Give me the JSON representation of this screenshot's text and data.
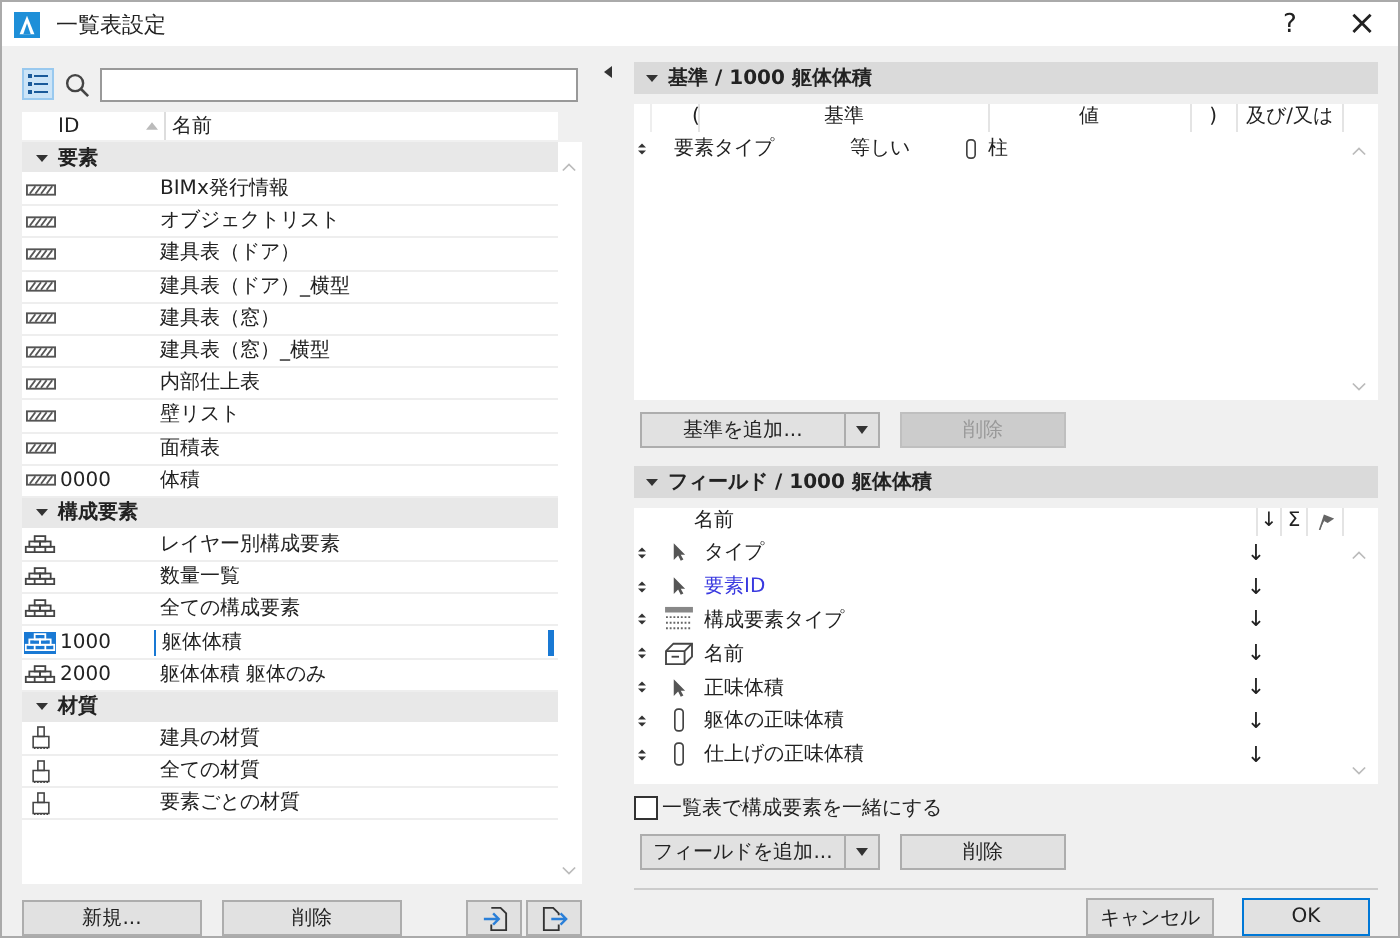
{
  "window": {
    "title": "一覧表設定",
    "help": "?",
    "close": "×"
  },
  "list": {
    "columns": [
      "ID",
      "名前"
    ],
    "groups": [
      {
        "label": "要素",
        "expanded": true,
        "items": [
          {
            "kind": "element",
            "name": "BIMx発行情報",
            "selected": false
          },
          {
            "kind": "element",
            "name": "オブジェクトリスト",
            "selected": false
          },
          {
            "kind": "element",
            "name": "建具表（ドア）",
            "selected": false
          },
          {
            "kind": "element",
            "name": "建具表（ドア）_横型",
            "selected": false
          },
          {
            "kind": "element",
            "name": "建具表（窓）",
            "selected": false
          },
          {
            "kind": "element",
            "name": "建具表（窓）_横型",
            "selected": false
          },
          {
            "kind": "element",
            "name": "内部仕上表",
            "selected": false
          },
          {
            "kind": "element",
            "name": "壁リスト",
            "selected": false
          },
          {
            "kind": "element",
            "name": "面積表",
            "selected": false
          },
          {
            "kind": "element",
            "id": "0000",
            "name": "体積",
            "selected": false
          }
        ]
      },
      {
        "label": "構成要素",
        "expanded": true,
        "items": [
          {
            "kind": "component",
            "name": "レイヤー別構成要素",
            "selected": false
          },
          {
            "kind": "component",
            "name": "数量一覧",
            "selected": false
          },
          {
            "kind": "component",
            "name": "全ての構成要素",
            "selected": false
          },
          {
            "kind": "component",
            "id": "1000",
            "name": "躯体体積",
            "selected": true
          },
          {
            "kind": "component",
            "id": "2000",
            "name": "躯体体積 躯体のみ",
            "selected": false
          }
        ]
      },
      {
        "label": "材質",
        "expanded": true,
        "items": [
          {
            "kind": "material",
            "name": "建具の材質",
            "selected": false
          },
          {
            "kind": "material",
            "name": "全ての材質",
            "selected": false
          },
          {
            "kind": "material",
            "name": "要素ごとの材質",
            "selected": false
          }
        ]
      }
    ],
    "buttons": [
      "新規...",
      "削除"
    ]
  },
  "criteria": {
    "title": "基準 / 1000 躯体体積",
    "expanded": true,
    "columns": [
      "(",
      "基準",
      "値",
      ")",
      "及び/又は"
    ],
    "rows": [
      {
        "criterion": "要素タイプ",
        "operator": "等しい",
        "value": "柱"
      }
    ],
    "add_button": "基準を追加...",
    "delete_button": {
      "label": "削除",
      "disabled": true
    }
  },
  "fields": {
    "title": "フィールド / 1000 躯体体積",
    "expanded": true,
    "columns": [
      "名前",
      "↓",
      "Σ"
    ],
    "rows": [
      {
        "kind": "pointer",
        "name": "タイプ",
        "highlighted": false,
        "sort": "↓"
      },
      {
        "kind": "pointer",
        "name": "要素ID",
        "highlighted": true,
        "sort": "↓"
      },
      {
        "kind": "hatch",
        "name": "構成要素タイプ",
        "highlighted": false,
        "sort": "↓"
      },
      {
        "kind": "object",
        "name": "名前",
        "highlighted": false,
        "sort": "↓"
      },
      {
        "kind": "pointer",
        "name": "正味体積",
        "highlighted": false,
        "sort": "↓"
      },
      {
        "kind": "column",
        "name": "躯体の正味体積",
        "highlighted": false,
        "sort": "↓"
      },
      {
        "kind": "column",
        "name": "仕上げの正味体積",
        "highlighted": false,
        "sort": "↓"
      }
    ],
    "checkbox": {
      "label": "一覧表で構成要素を一緒にする",
      "checked": false
    },
    "add_button": "フィールドを追加...",
    "delete_button": {
      "label": "削除",
      "disabled": false
    }
  },
  "footer": {
    "cancel": "キャンセル",
    "ok": "OK"
  }
}
